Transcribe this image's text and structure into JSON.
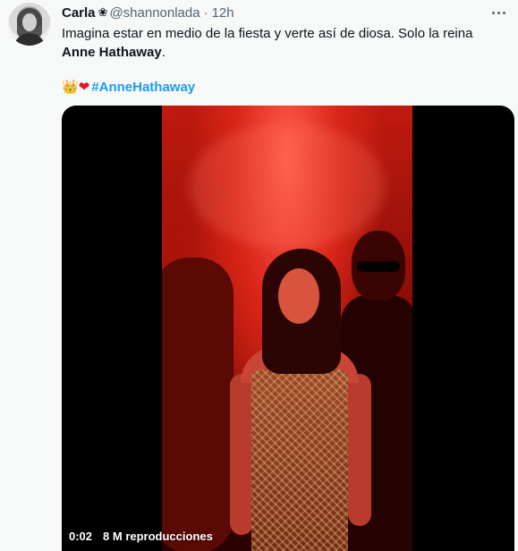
{
  "tweet": {
    "author_name": "Carla",
    "author_flower": "❀",
    "author_handle": "@shannonlada",
    "separator": "·",
    "time": "12h",
    "text_line1": "Imagina estar en medio de la fiesta y verte así de diosa. Solo la reina",
    "text_line2_bold": "Anne Hathaway",
    "text_line2_end": ".",
    "emoji_crown": "👑",
    "emoji_heart": "❤",
    "hashtag": "#AnneHathaway"
  },
  "video": {
    "elapsed": "0:02",
    "views": "8 M reproducciones"
  },
  "colors": {
    "link": "#1d9bf0",
    "secondary_text": "#536471",
    "background": "#f7f9f9"
  },
  "icons": {
    "more": "more-horizontal-icon"
  }
}
